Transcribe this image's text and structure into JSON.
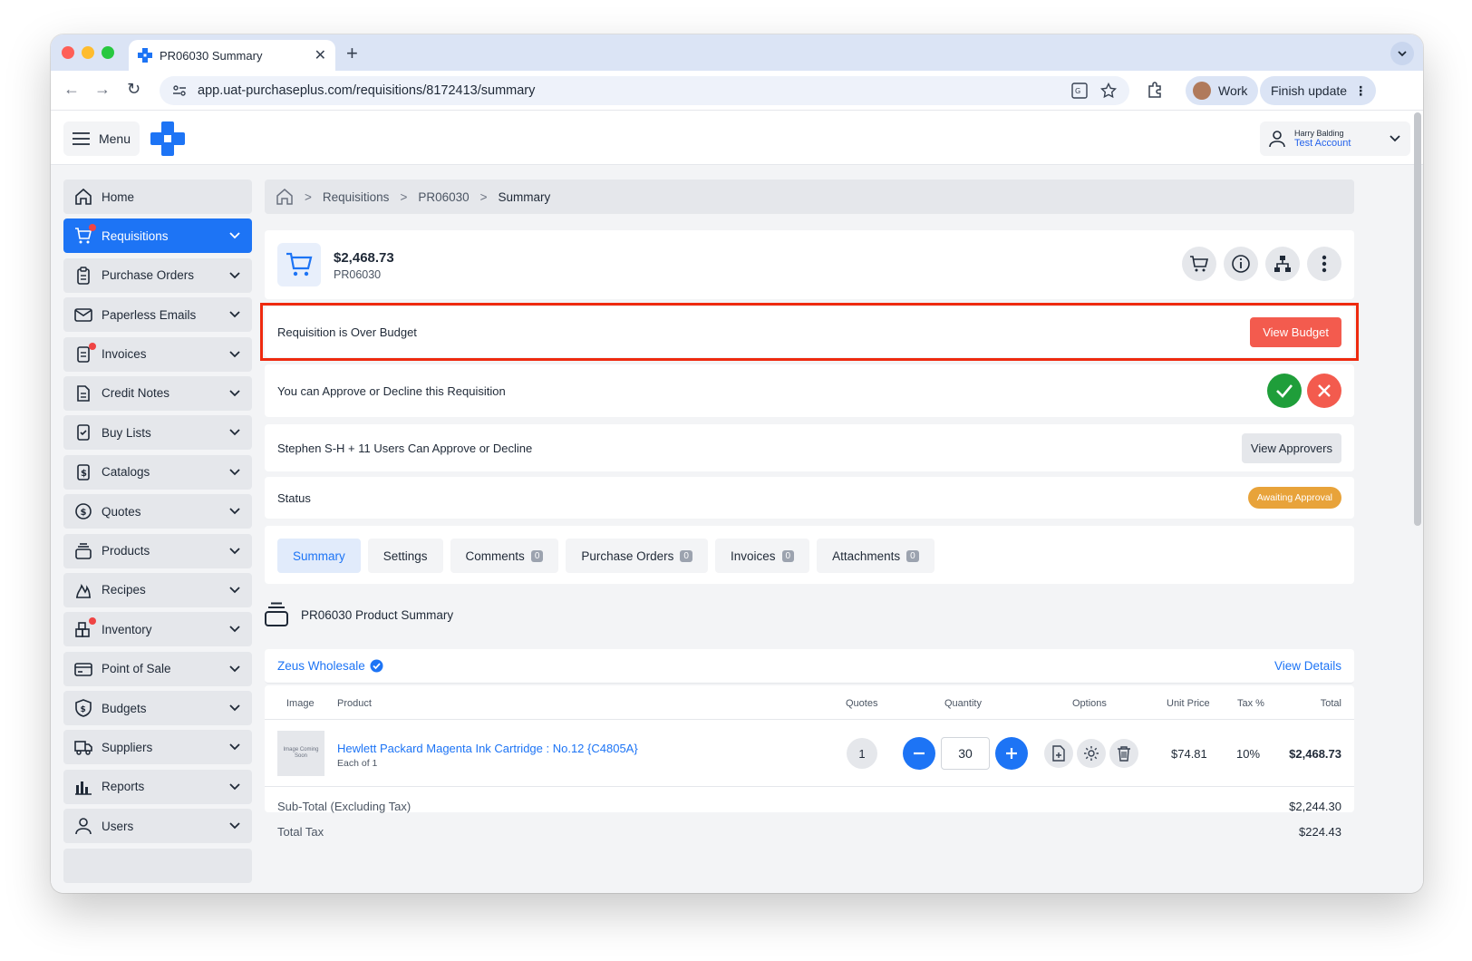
{
  "browser": {
    "tab_title": "PR06030 Summary",
    "new_tab": "+",
    "close": "✕",
    "url": "app.uat-purchaseplus.com/requisitions/8172413/summary",
    "profile_label": "Work",
    "update_label": "Finish update"
  },
  "app": {
    "menu_label": "Menu",
    "user_name": "Harry Balding",
    "user_account": "Test Account"
  },
  "sidebar": {
    "items": [
      {
        "label": "Home",
        "icon": "home-icon"
      },
      {
        "label": "Requisitions",
        "icon": "cart-icon"
      },
      {
        "label": "Purchase Orders",
        "icon": "clipboard-icon"
      },
      {
        "label": "Paperless Emails",
        "icon": "mail-icon"
      },
      {
        "label": "Invoices",
        "icon": "invoice-icon"
      },
      {
        "label": "Credit Notes",
        "icon": "document-icon"
      },
      {
        "label": "Buy Lists",
        "icon": "checklist-icon"
      },
      {
        "label": "Catalogs",
        "icon": "dollar-file-icon"
      },
      {
        "label": "Quotes",
        "icon": "dollar-circle-icon"
      },
      {
        "label": "Products",
        "icon": "stack-icon"
      },
      {
        "label": "Recipes",
        "icon": "flame-icon"
      },
      {
        "label": "Inventory",
        "icon": "boxes-icon"
      },
      {
        "label": "Point of Sale",
        "icon": "card-icon"
      },
      {
        "label": "Budgets",
        "icon": "shield-dollar-icon"
      },
      {
        "label": "Suppliers",
        "icon": "truck-icon"
      },
      {
        "label": "Reports",
        "icon": "bar-chart-icon"
      },
      {
        "label": "Users",
        "icon": "user-icon"
      }
    ]
  },
  "breadcrumb": {
    "items": [
      "Requisitions",
      "PR06030",
      "Summary"
    ],
    "sep": ">"
  },
  "header": {
    "amount": "$2,468.73",
    "pr_number": "PR06030"
  },
  "budget": {
    "message": "Requisition is Over Budget",
    "button": "View Budget"
  },
  "approval": {
    "message": "You can Approve or Decline this Requisition"
  },
  "approvers": {
    "message": "Stephen S-H + 11 Users Can Approve or Decline",
    "button": "View Approvers"
  },
  "status": {
    "label": "Status",
    "value": "Awaiting Approval"
  },
  "tabs": [
    {
      "label": "Summary",
      "count": null
    },
    {
      "label": "Settings",
      "count": null
    },
    {
      "label": "Comments",
      "count": "0"
    },
    {
      "label": "Purchase Orders",
      "count": "0"
    },
    {
      "label": "Invoices",
      "count": "0"
    },
    {
      "label": "Attachments",
      "count": "0"
    }
  ],
  "product_summary": {
    "title": "PR06030 Product Summary"
  },
  "supplier": {
    "name": "Zeus Wholesale",
    "view_details": "View Details"
  },
  "table": {
    "headers": [
      "Image",
      "Product",
      "Quotes",
      "Quantity",
      "Options",
      "Unit Price",
      "Tax %",
      "Total"
    ],
    "row": {
      "image_placeholder": "Image Coming Soon",
      "product": "Hewlett Packard Magenta Ink Cartridge : No.12 {C4805A}",
      "unit": "Each of 1",
      "quotes": "1",
      "quantity": "30",
      "unit_price": "$74.81",
      "tax": "10%",
      "total": "$2,468.73"
    }
  },
  "totals": {
    "subtotal_label": "Sub-Total (Excluding Tax)",
    "subtotal_value": "$2,244.30",
    "tax_label": "Total Tax",
    "tax_value": "$224.43"
  },
  "colors": {
    "primary": "#1d74f5",
    "danger": "#f35b4e",
    "success": "#1f9e3a",
    "warning": "#e8a33a",
    "highlight": "#ee2a0f"
  }
}
